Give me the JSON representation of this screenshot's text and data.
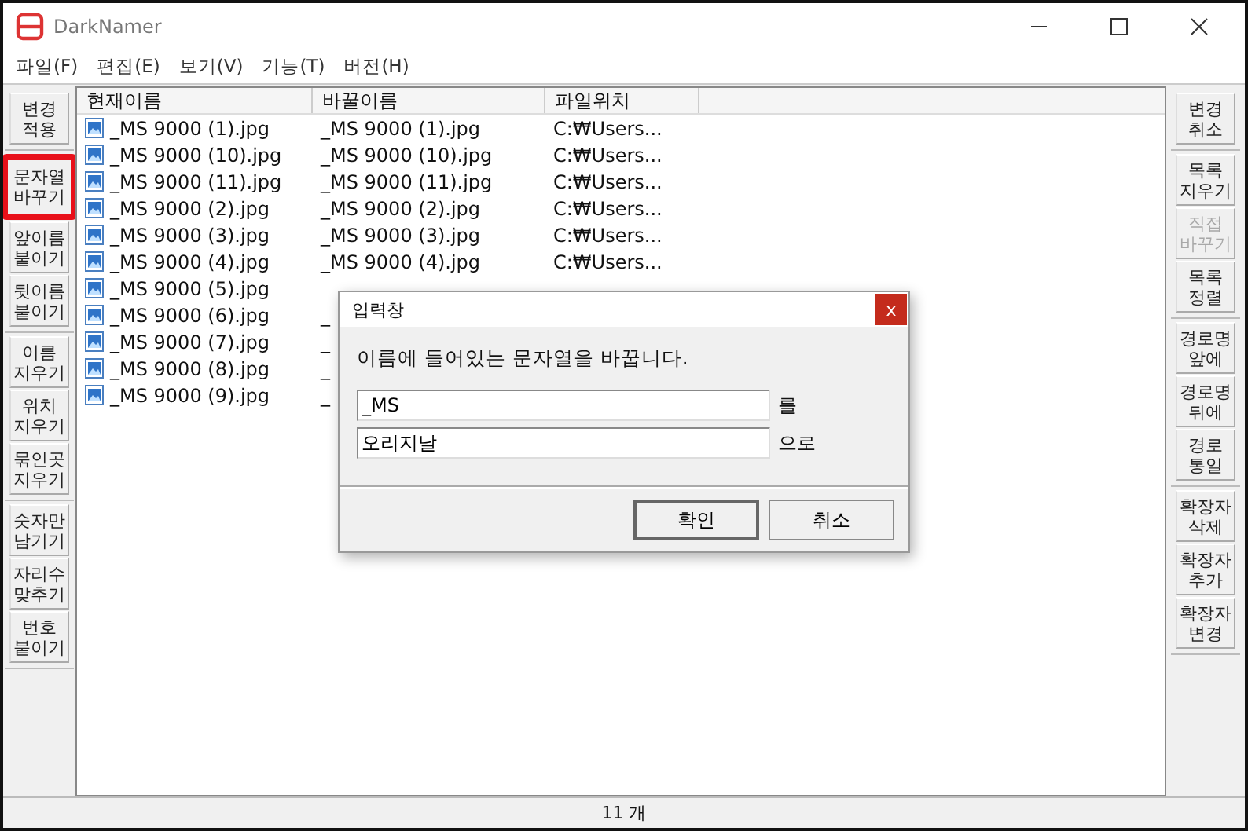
{
  "window": {
    "title": "DarkNamer"
  },
  "menu": [
    "파일(F)",
    "편집(E)",
    "보기(V)",
    "기능(T)",
    "버전(H)"
  ],
  "left_toolbar": [
    [
      {
        "label": "변경\n적용",
        "disabled": false,
        "highlighted": false
      }
    ],
    [
      {
        "label": "문자열\n바꾸기",
        "disabled": false,
        "highlighted": true
      },
      {
        "label": "앞이름\n붙이기",
        "disabled": false,
        "highlighted": false
      },
      {
        "label": "뒷이름\n붙이기",
        "disabled": false,
        "highlighted": false
      }
    ],
    [
      {
        "label": "이름\n지우기",
        "disabled": false,
        "highlighted": false
      },
      {
        "label": "위치\n지우기",
        "disabled": false,
        "highlighted": false
      },
      {
        "label": "묶인곳\n지우기",
        "disabled": false,
        "highlighted": false
      }
    ],
    [
      {
        "label": "숫자만\n남기기",
        "disabled": false,
        "highlighted": false
      },
      {
        "label": "자리수\n맞추기",
        "disabled": false,
        "highlighted": false
      },
      {
        "label": "번호\n붙이기",
        "disabled": false,
        "highlighted": false
      }
    ]
  ],
  "right_toolbar": [
    [
      {
        "label": "변경\n취소",
        "disabled": false,
        "highlighted": false
      }
    ],
    [
      {
        "label": "목록\n지우기",
        "disabled": false,
        "highlighted": false
      },
      {
        "label": "직접\n바꾸기",
        "disabled": true,
        "highlighted": false
      },
      {
        "label": "목록\n정렬",
        "disabled": false,
        "highlighted": false
      }
    ],
    [
      {
        "label": "경로명\n앞에",
        "disabled": false,
        "highlighted": false
      },
      {
        "label": "경로명\n뒤에",
        "disabled": false,
        "highlighted": false
      },
      {
        "label": "경로\n통일",
        "disabled": false,
        "highlighted": false
      }
    ],
    [
      {
        "label": "확장자\n삭제",
        "disabled": false,
        "highlighted": false
      },
      {
        "label": "확장자\n추가",
        "disabled": false,
        "highlighted": false
      },
      {
        "label": "확장자\n변경",
        "disabled": false,
        "highlighted": false
      }
    ]
  ],
  "table": {
    "columns": [
      "현재이름",
      "바꿀이름",
      "파일위치"
    ],
    "rows": [
      {
        "current": "_MS 9000 (1).jpg",
        "new": "_MS 9000 (1).jpg",
        "path": "C:₩Users..."
      },
      {
        "current": "_MS 9000 (10).jpg",
        "new": "_MS 9000 (10).jpg",
        "path": "C:₩Users..."
      },
      {
        "current": "_MS 9000 (11).jpg",
        "new": "_MS 9000 (11).jpg",
        "path": "C:₩Users..."
      },
      {
        "current": "_MS 9000 (2).jpg",
        "new": "_MS 9000 (2).jpg",
        "path": "C:₩Users..."
      },
      {
        "current": "_MS 9000 (3).jpg",
        "new": "_MS 9000 (3).jpg",
        "path": "C:₩Users..."
      },
      {
        "current": "_MS 9000 (4).jpg",
        "new": "_MS 9000 (4).jpg",
        "path": "C:₩Users..."
      },
      {
        "current": "_MS 9000 (5).jpg"
      },
      {
        "current": "_MS 9000 (6).jpg",
        "new": "_"
      },
      {
        "current": "_MS 9000 (7).jpg",
        "new": "_"
      },
      {
        "current": "_MS 9000 (8).jpg",
        "new": "_"
      },
      {
        "current": "_MS 9000 (9).jpg",
        "new": "_"
      }
    ]
  },
  "dialog": {
    "title": "입력창",
    "close": "x",
    "message": "이름에 들어있는 문자열을 바꿉니다.",
    "fields": [
      {
        "value": "_MS",
        "suffix": "를"
      },
      {
        "value": "오리지날",
        "suffix": "으로"
      }
    ],
    "buttons": [
      "확인",
      "취소"
    ]
  },
  "status_bar": "11 개"
}
